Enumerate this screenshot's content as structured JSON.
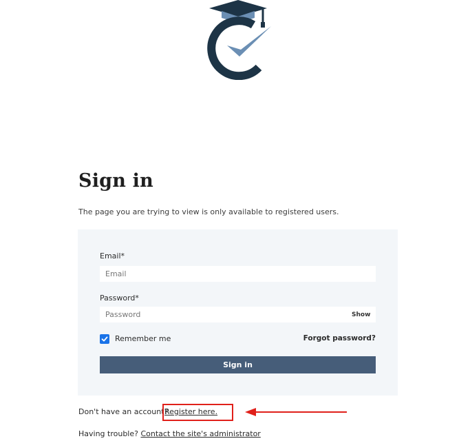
{
  "page": {
    "title": "Sign in",
    "notice": "The page you are trying to view is only available to registered users."
  },
  "form": {
    "email_label": "Email*",
    "email_placeholder": "Email",
    "password_label": "Password*",
    "password_placeholder": "Password",
    "show_label": "Show",
    "remember_label": "Remember me",
    "remember_checked": true,
    "forgot_label": "Forgot password?",
    "submit_label": "Sign in"
  },
  "footer": {
    "register_prompt": "Don't have an account?",
    "register_link": "Register here.",
    "trouble_prompt": "Having trouble?",
    "contact_link": "Contact the site's administrator"
  },
  "colors": {
    "button": "#465d79",
    "card": "#f3f6f9",
    "checkbox": "#1a73e8",
    "annotation": "#e0201a",
    "logo_dark": "#1d3446",
    "logo_light": "#6b8fb4"
  },
  "icons": {
    "logo": "graduation-cap-c-check-logo",
    "checkbox": "checkmark-icon",
    "annotation": "red-arrow-left-icon"
  }
}
